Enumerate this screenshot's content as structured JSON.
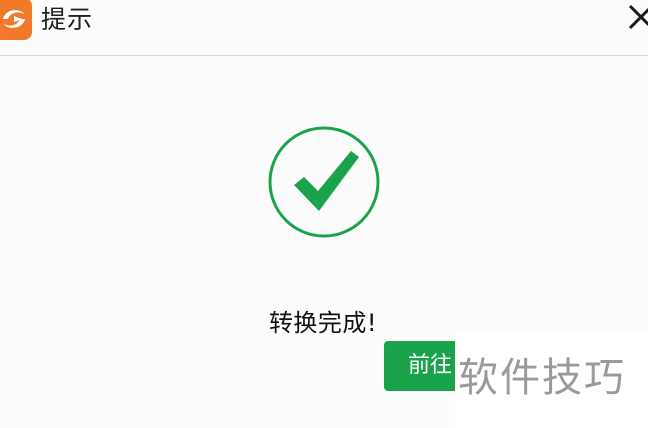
{
  "window": {
    "title": "提示",
    "logo_icon": "app-logo-icon",
    "close_icon": "close-icon"
  },
  "dialog": {
    "status_icon": "success-check-icon",
    "status_color": "#1aa34a",
    "message": "转换完成!",
    "action_button_label": "前往",
    "action_button_color": "#1aa34a"
  },
  "watermark": {
    "text": "软件技巧"
  }
}
